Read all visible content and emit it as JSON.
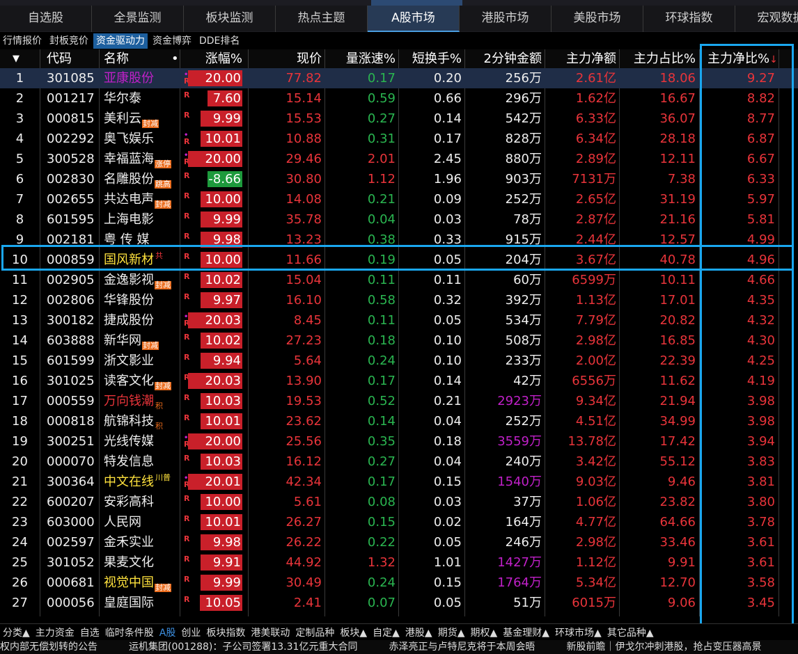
{
  "colors": {
    "up": "#e8343a",
    "down": "#2ab550",
    "highlight": "#1aa7ef",
    "active_tab": "#273a55"
  },
  "tabs": [
    "自选股",
    "全景监测",
    "板块监测",
    "热点主题",
    "A股市场",
    "港股市场",
    "美股市场",
    "环球指数",
    "宏观数据"
  ],
  "active_tab": "A股市场",
  "subtabs": [
    "行情报价",
    "封板竞价",
    "资金驱动力",
    "资金博弈",
    "DDE排名"
  ],
  "active_subtab": "资金驱动力",
  "columns": {
    "idx": "▼",
    "code": "代码",
    "name": "名称",
    "name_dot": "•",
    "chg": "涨幅%",
    "price": "现价",
    "speed": "量涨速%",
    "turnover": "短换手%",
    "amt": "2分钟金额",
    "net": "主力净额",
    "ratio": "主力占比%",
    "netratio": "主力净比%",
    "sort_icon": "↓"
  },
  "rows": [
    {
      "i": "1",
      "code": "301085",
      "name": "亚康股份",
      "tag": "",
      "chg": "20.00",
      "price": "77.82",
      "speed": "0.17",
      "turnover": "0.20",
      "amt": "256万",
      "net": "2.61亿",
      "ratio": "18.06",
      "netratio": "9.27"
    },
    {
      "i": "2",
      "code": "001217",
      "name": "华尔泰",
      "tag": "",
      "chg": "7.60",
      "price": "15.14",
      "speed": "0.59",
      "turnover": "0.66",
      "amt": "296万",
      "net": "1.62亿",
      "ratio": "16.67",
      "netratio": "8.82"
    },
    {
      "i": "3",
      "code": "000815",
      "name": "美利云",
      "tag": "封减",
      "chg": "9.99",
      "price": "15.53",
      "speed": "0.27",
      "turnover": "0.14",
      "amt": "542万",
      "net": "6.33亿",
      "ratio": "36.07",
      "netratio": "8.77"
    },
    {
      "i": "4",
      "code": "002292",
      "name": "奥飞娱乐",
      "tag": "",
      "chg": "10.01",
      "price": "10.88",
      "speed": "0.31",
      "turnover": "0.17",
      "amt": "828万",
      "net": "6.34亿",
      "ratio": "28.18",
      "netratio": "6.87"
    },
    {
      "i": "5",
      "code": "300528",
      "name": "幸福蓝海",
      "tag": "涨停",
      "chg": "20.00",
      "price": "29.46",
      "speed": "2.01",
      "turnover": "2.45",
      "amt": "880万",
      "net": "2.89亿",
      "ratio": "12.11",
      "netratio": "6.67"
    },
    {
      "i": "6",
      "code": "002830",
      "name": "名雕股份",
      "tag": "跳高",
      "chg": "-8.66",
      "price": "30.80",
      "speed": "1.12",
      "turnover": "1.96",
      "amt": "903万",
      "net": "7131万",
      "ratio": "7.38",
      "netratio": "6.33"
    },
    {
      "i": "7",
      "code": "002655",
      "name": "共达电声",
      "tag": "封减",
      "chg": "10.00",
      "price": "14.08",
      "speed": "0.21",
      "turnover": "0.09",
      "amt": "252万",
      "net": "2.65亿",
      "ratio": "31.19",
      "netratio": "5.97"
    },
    {
      "i": "8",
      "code": "601595",
      "name": "上海电影",
      "tag": "",
      "chg": "9.99",
      "price": "35.78",
      "speed": "0.04",
      "turnover": "0.03",
      "amt": "78万",
      "net": "2.87亿",
      "ratio": "21.16",
      "netratio": "5.81"
    },
    {
      "i": "9",
      "code": "002181",
      "name": "粤 传 媒",
      "tag": "",
      "chg": "9.98",
      "price": "13.23",
      "speed": "0.38",
      "turnover": "0.33",
      "amt": "915万",
      "net": "2.44亿",
      "ratio": "12.57",
      "netratio": "4.99"
    },
    {
      "i": "10",
      "code": "000859",
      "name": "国风新材",
      "tag": "共",
      "chg": "10.00",
      "price": "11.66",
      "speed": "0.19",
      "turnover": "0.05",
      "amt": "204万",
      "net": "3.67亿",
      "ratio": "40.78",
      "netratio": "4.96"
    },
    {
      "i": "11",
      "code": "002905",
      "name": "金逸影视",
      "tag": "封减",
      "chg": "10.02",
      "price": "15.04",
      "speed": "0.11",
      "turnover": "0.11",
      "amt": "60万",
      "net": "6599万",
      "ratio": "10.11",
      "netratio": "4.66"
    },
    {
      "i": "12",
      "code": "002806",
      "name": "华锋股份",
      "tag": "",
      "chg": "9.97",
      "price": "16.10",
      "speed": "0.58",
      "turnover": "0.32",
      "amt": "392万",
      "net": "1.13亿",
      "ratio": "17.01",
      "netratio": "4.35"
    },
    {
      "i": "13",
      "code": "300182",
      "name": "捷成股份",
      "tag": "",
      "chg": "20.03",
      "price": "8.45",
      "speed": "0.11",
      "turnover": "0.05",
      "amt": "534万",
      "net": "7.79亿",
      "ratio": "20.82",
      "netratio": "4.32"
    },
    {
      "i": "14",
      "code": "603888",
      "name": "新华网",
      "tag": "封减",
      "chg": "10.02",
      "price": "27.23",
      "speed": "0.18",
      "turnover": "0.10",
      "amt": "508万",
      "net": "2.98亿",
      "ratio": "16.85",
      "netratio": "4.30"
    },
    {
      "i": "15",
      "code": "601599",
      "name": "浙文影业",
      "tag": "",
      "chg": "9.94",
      "price": "5.64",
      "speed": "0.24",
      "turnover": "0.10",
      "amt": "233万",
      "net": "2.00亿",
      "ratio": "22.39",
      "netratio": "4.25"
    },
    {
      "i": "16",
      "code": "301025",
      "name": "读客文化",
      "tag": "封减",
      "chg": "20.03",
      "price": "13.90",
      "speed": "0.17",
      "turnover": "0.14",
      "amt": "42万",
      "net": "6556万",
      "ratio": "11.62",
      "netratio": "4.19"
    },
    {
      "i": "17",
      "code": "000559",
      "name": "万向钱潮",
      "tag": "积",
      "chg": "10.03",
      "price": "19.53",
      "speed": "0.52",
      "turnover": "0.21",
      "amt": "2923万",
      "net": "9.34亿",
      "ratio": "21.94",
      "netratio": "3.98"
    },
    {
      "i": "18",
      "code": "000818",
      "name": "航锦科技",
      "tag": "积",
      "chg": "10.01",
      "price": "23.62",
      "speed": "0.14",
      "turnover": "0.04",
      "amt": "252万",
      "net": "4.51亿",
      "ratio": "34.99",
      "netratio": "3.98"
    },
    {
      "i": "19",
      "code": "300251",
      "name": "光线传媒",
      "tag": "",
      "chg": "20.00",
      "price": "25.56",
      "speed": "0.35",
      "turnover": "0.18",
      "amt": "3559万",
      "net": "13.78亿",
      "ratio": "17.42",
      "netratio": "3.94"
    },
    {
      "i": "20",
      "code": "000070",
      "name": "特发信息",
      "tag": "",
      "chg": "10.03",
      "price": "16.12",
      "speed": "0.27",
      "turnover": "0.04",
      "amt": "240万",
      "net": "3.42亿",
      "ratio": "55.12",
      "netratio": "3.83"
    },
    {
      "i": "21",
      "code": "300364",
      "name": "中文在线",
      "tag": "川普",
      "chg": "20.01",
      "price": "42.34",
      "speed": "0.17",
      "turnover": "0.15",
      "amt": "1540万",
      "net": "9.03亿",
      "ratio": "9.46",
      "netratio": "3.81"
    },
    {
      "i": "22",
      "code": "600207",
      "name": "安彩高科",
      "tag": "",
      "chg": "10.00",
      "price": "5.61",
      "speed": "0.08",
      "turnover": "0.03",
      "amt": "37万",
      "net": "1.06亿",
      "ratio": "23.82",
      "netratio": "3.80"
    },
    {
      "i": "23",
      "code": "603000",
      "name": "人民网",
      "tag": "",
      "chg": "10.01",
      "price": "26.27",
      "speed": "0.15",
      "turnover": "0.02",
      "amt": "164万",
      "net": "4.77亿",
      "ratio": "64.66",
      "netratio": "3.78"
    },
    {
      "i": "24",
      "code": "002597",
      "name": "金禾实业",
      "tag": "",
      "chg": "9.98",
      "price": "26.22",
      "speed": "0.22",
      "turnover": "0.05",
      "amt": "246万",
      "net": "2.98亿",
      "ratio": "33.46",
      "netratio": "3.61"
    },
    {
      "i": "25",
      "code": "301052",
      "name": "果麦文化",
      "tag": "",
      "chg": "9.91",
      "price": "44.92",
      "speed": "1.32",
      "turnover": "1.01",
      "amt": "1427万",
      "net": "1.12亿",
      "ratio": "9.91",
      "netratio": "3.61"
    },
    {
      "i": "26",
      "code": "000681",
      "name": "视觉中国",
      "tag": "封减",
      "chg": "9.99",
      "price": "30.49",
      "speed": "0.24",
      "turnover": "0.15",
      "amt": "1764万",
      "net": "5.34亿",
      "ratio": "12.70",
      "netratio": "3.58"
    },
    {
      "i": "27",
      "code": "000056",
      "name": "皇庭国际",
      "tag": "",
      "chg": "10.05",
      "price": "2.41",
      "speed": "0.07",
      "turnover": "0.05",
      "amt": "51万",
      "net": "6015万",
      "ratio": "9.06",
      "netratio": "3.45"
    }
  ],
  "bottom_tabs": [
    "分类▲",
    "主力资金",
    "自选",
    "临时条件股",
    "A股",
    "创业",
    "板块指数",
    "港美联动",
    "定制品种",
    "板块▲",
    "自定▲",
    "港股▲",
    "期货▲",
    "期权▲",
    "基金理财▲",
    "环球市场▲",
    "其它品种▲"
  ],
  "active_bottom_tab": "A股",
  "ticker": [
    "权内部无偿划转的公告",
    "运机集团(001288)：子公司签署13.31亿元重大合同",
    "赤泽亮正与卢特尼克将于本周会晤",
    "新股前瞻｜伊戈尔冲刺港股，抢占变压器高景"
  ]
}
